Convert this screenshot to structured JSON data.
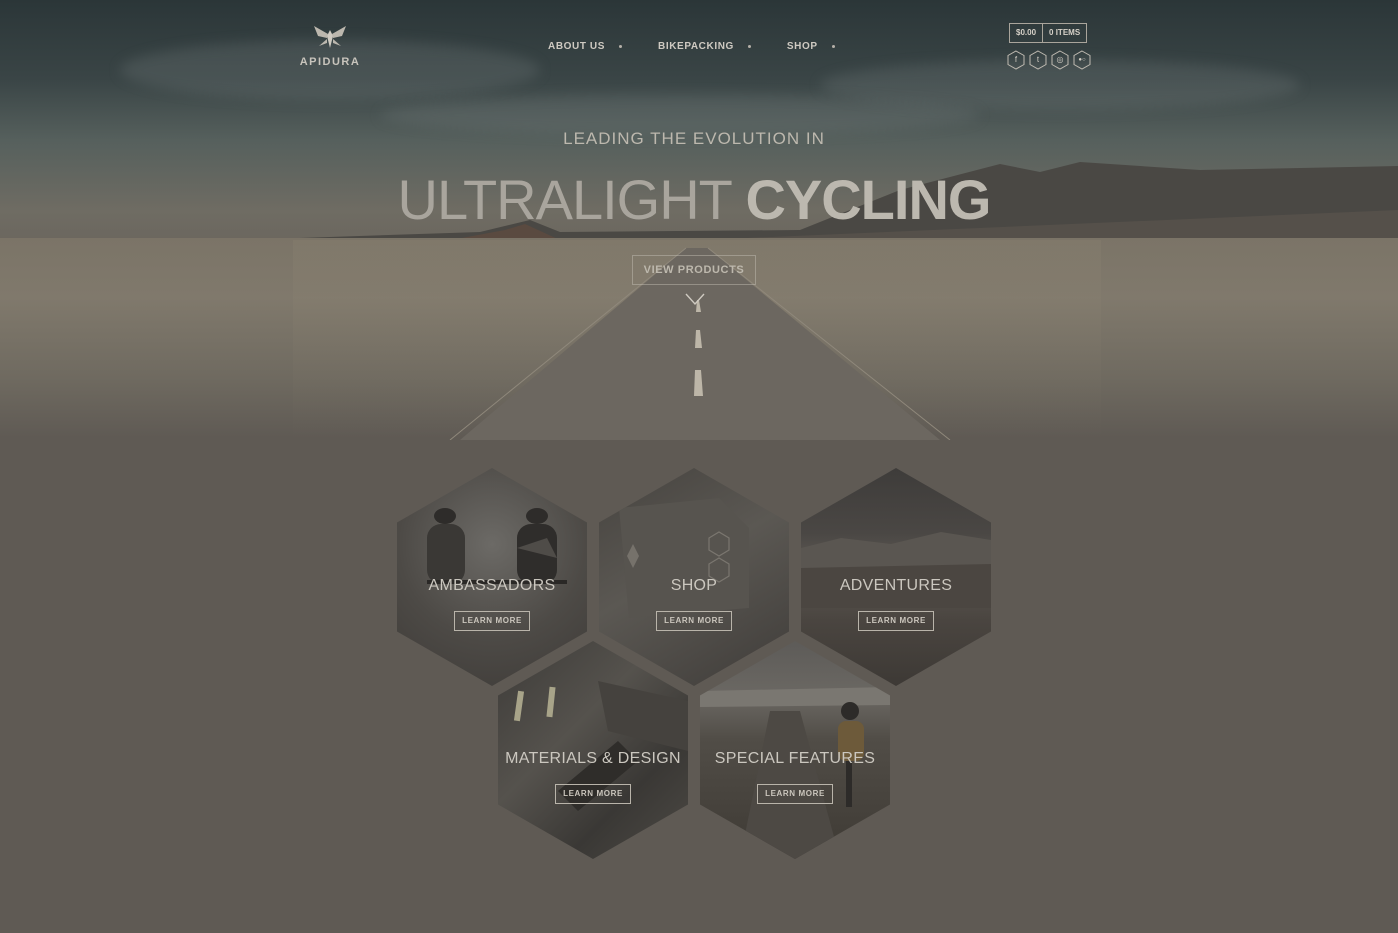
{
  "brand": {
    "name": "APIDURA"
  },
  "nav": {
    "items": [
      {
        "label": "ABOUT US"
      },
      {
        "label": "BIKEPACKING"
      },
      {
        "label": "SHOP"
      }
    ]
  },
  "cart": {
    "total": "$0.00",
    "items": "0 ITEMS"
  },
  "social": [
    {
      "icon": "facebook-icon",
      "glyph": "f"
    },
    {
      "icon": "twitter-icon",
      "glyph": "t"
    },
    {
      "icon": "instagram-icon",
      "glyph": "◎"
    },
    {
      "icon": "flickr-icon",
      "glyph": "●○"
    }
  ],
  "hero": {
    "kicker": "LEADING THE EVOLUTION IN",
    "headline_light": "ULTRALIGHT",
    "headline_bold": "CYCLING",
    "cta": "VIEW PRODUCTS"
  },
  "tiles": [
    {
      "title": "AMBASSADORS",
      "button": "LEARN MORE"
    },
    {
      "title": "SHOP",
      "button": "LEARN MORE"
    },
    {
      "title": "ADVENTURES",
      "button": "LEARN MORE"
    },
    {
      "title": "MATERIALS & DESIGN",
      "button": "LEARN MORE"
    },
    {
      "title": "SPECIAL FEATURES",
      "button": "LEARN MORE"
    }
  ],
  "colors": {
    "background": "#5f5a54",
    "text": "#d8d4cc",
    "sky": "#2b3638"
  }
}
